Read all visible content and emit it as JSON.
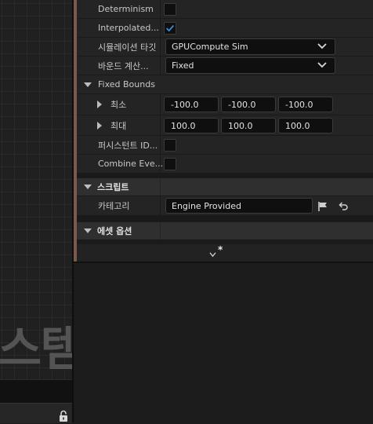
{
  "viewport": {
    "watermark_text": "스템"
  },
  "details": {
    "rows": {
      "determinism": {
        "label": "Determinism",
        "checked": false
      },
      "interpolated": {
        "label": "Interpolated...",
        "checked": true
      },
      "sim_target": {
        "label": "시뮬레이션 타깃",
        "value": "GPUCompute Sim"
      },
      "bounds_calc": {
        "label": "바운드 계산...",
        "value": "Fixed"
      },
      "fixed_bounds": {
        "label": "Fixed Bounds"
      },
      "min": {
        "label": "최소",
        "x": "-100.0",
        "y": "-100.0",
        "z": "-100.0"
      },
      "max": {
        "label": "최대",
        "x": "100.0",
        "y": "100.0",
        "z": "100.0"
      },
      "persistent_id": {
        "label": "퍼시스턴트 ID...",
        "checked": false
      },
      "combine_events": {
        "label": "Combine Eve...",
        "checked": false
      }
    },
    "sections": {
      "script": {
        "label": "스크립트"
      },
      "asset_options": {
        "label": "에셋 옵션"
      }
    },
    "category": {
      "label": "카테고리",
      "value": "Engine Provided"
    },
    "footer": {
      "more_marker": "*"
    }
  },
  "colors": {
    "accent": "#7b5a4c",
    "check": "#3a8de0"
  }
}
